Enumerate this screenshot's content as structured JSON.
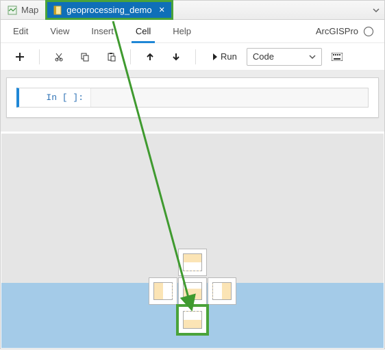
{
  "tabs": {
    "map": {
      "label": "Map"
    },
    "notebook": {
      "label": "geoprocessing_demo"
    }
  },
  "menu": {
    "edit": "Edit",
    "view": "View",
    "insert": "Insert",
    "cell": "Cell",
    "help": "Help"
  },
  "kernel": {
    "name": "ArcGISPro"
  },
  "toolbar": {
    "add": "+",
    "cut": "✂",
    "copy": "⧉",
    "paste": "📋",
    "up": "↑",
    "down": "↓",
    "run": "Run",
    "cell_type": "Code",
    "keyboard": "⌨"
  },
  "cell": {
    "prompt": "In [ ]:"
  }
}
